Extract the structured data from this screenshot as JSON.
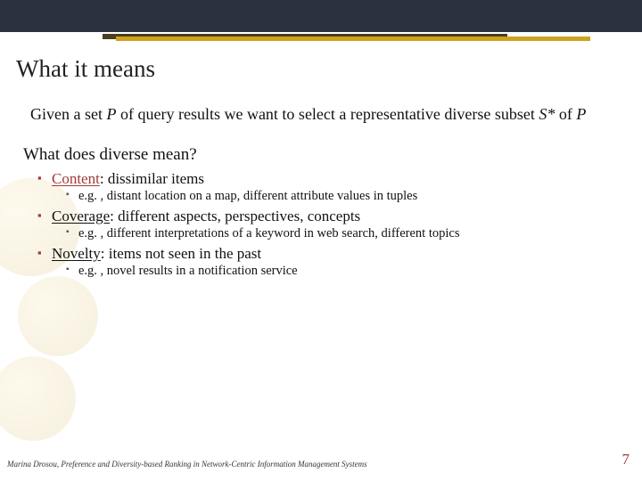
{
  "header": {
    "title": "What it means"
  },
  "intro": {
    "pre": "Given a set ",
    "P": "P",
    "mid": " of query results we want to select a representative diverse subset ",
    "S": "S*",
    "of": " of ",
    "P2": "P"
  },
  "subheading": "What does diverse mean?",
  "bullets": [
    {
      "term": "Content",
      "rest": ": dissimilar items",
      "sub": "e.g. , distant location on a map, different attribute values in tuples",
      "highlight": true
    },
    {
      "term": "Coverage",
      "rest": ": different aspects, perspectives, concepts",
      "sub": "e.g. , different interpretations of a keyword in web search, different topics",
      "highlight": false
    },
    {
      "term": "Novelty",
      "rest": ": items not seen in the past",
      "sub": "e.g. , novel results in a notification service",
      "highlight": false
    }
  ],
  "footer": {
    "citation": "Marina Drosou, Preference and Diversity-based Ranking in Network-Centric Information Management Systems",
    "page": "7"
  }
}
